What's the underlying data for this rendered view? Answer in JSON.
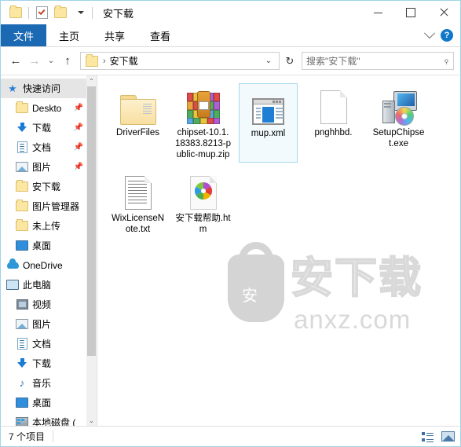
{
  "window": {
    "title": "安下载",
    "quick_access_toolbar": [
      {
        "name": "folder-icon",
        "label": "属性"
      },
      {
        "name": "properties-icon",
        "label": "属性"
      },
      {
        "name": "new-folder-icon",
        "label": "新建文件夹"
      },
      {
        "name": "customize-dropdown",
        "label": "▾"
      }
    ],
    "controls": {
      "minimize": "—",
      "maximize": "▢",
      "close": "✕"
    }
  },
  "ribbon": {
    "tabs": [
      {
        "label": "文件",
        "active": true
      },
      {
        "label": "主页",
        "active": false
      },
      {
        "label": "共享",
        "active": false
      },
      {
        "label": "查看",
        "active": false
      }
    ],
    "collapse_label": "⌄",
    "help_label": "?"
  },
  "address_bar": {
    "back": "←",
    "forward": "→",
    "recent": "⌄",
    "up": "↑",
    "breadcrumb_separator": "›",
    "path": "安下载",
    "path_dropdown": "⌄",
    "refresh": "↻",
    "search_placeholder": "搜索\"安下载\"",
    "search_value": "",
    "search_icon": "⌕"
  },
  "sidebar": {
    "items": [
      {
        "label": "快速访问",
        "icon": "star-pin-icon",
        "level": 1,
        "selected": true,
        "pinned": false
      },
      {
        "label": "Deskto",
        "icon": "folder-icon",
        "level": 2,
        "selected": false,
        "pinned": true
      },
      {
        "label": "下载",
        "icon": "download-icon",
        "level": 2,
        "selected": false,
        "pinned": true
      },
      {
        "label": "文档",
        "icon": "document-icon",
        "level": 2,
        "selected": false,
        "pinned": true
      },
      {
        "label": "图片",
        "icon": "pictures-icon",
        "level": 2,
        "selected": false,
        "pinned": true
      },
      {
        "label": "安下载",
        "icon": "folder-icon",
        "level": 2,
        "selected": false,
        "pinned": false
      },
      {
        "label": "图片管理器",
        "icon": "folder-icon",
        "level": 2,
        "selected": false,
        "pinned": false
      },
      {
        "label": "未上传",
        "icon": "folder-icon",
        "level": 2,
        "selected": false,
        "pinned": false
      },
      {
        "label": "桌面",
        "icon": "desktop-icon",
        "level": 2,
        "selected": false,
        "pinned": false
      },
      {
        "label": "OneDrive",
        "icon": "cloud-icon",
        "level": 1,
        "selected": false,
        "pinned": false
      },
      {
        "label": "此电脑",
        "icon": "computer-icon",
        "level": 1,
        "selected": false,
        "pinned": false
      },
      {
        "label": "视频",
        "icon": "video-icon",
        "level": 2,
        "selected": false,
        "pinned": false
      },
      {
        "label": "图片",
        "icon": "pictures-icon",
        "level": 2,
        "selected": false,
        "pinned": false
      },
      {
        "label": "文档",
        "icon": "document-icon",
        "level": 2,
        "selected": false,
        "pinned": false
      },
      {
        "label": "下载",
        "icon": "download-icon",
        "level": 2,
        "selected": false,
        "pinned": false
      },
      {
        "label": "音乐",
        "icon": "music-icon",
        "level": 2,
        "selected": false,
        "pinned": false
      },
      {
        "label": "桌面",
        "icon": "desktop-icon",
        "level": 2,
        "selected": false,
        "pinned": false
      },
      {
        "label": "本地磁盘 (",
        "icon": "disk-icon",
        "level": 2,
        "selected": false,
        "pinned": false
      }
    ],
    "scroll_up": "⌃",
    "scroll_down": "⌄"
  },
  "files": [
    {
      "name": "DriverFiles",
      "icon": "folder-icon",
      "selected": false
    },
    {
      "name": "chipset-10.1.18383.8213-public-mup.zip",
      "icon": "zip-archive-icon",
      "selected": false
    },
    {
      "name": "mup.xml",
      "icon": "xml-file-icon",
      "selected": true
    },
    {
      "name": "pnghhbd.",
      "icon": "blank-page-icon",
      "selected": false
    },
    {
      "name": "SetupChipset.exe",
      "icon": "setup-executable-icon",
      "selected": false
    },
    {
      "name": "WixLicenseNote.txt",
      "icon": "text-file-icon",
      "selected": false
    },
    {
      "name": "安下载帮助.htm",
      "icon": "html-file-icon",
      "selected": false
    }
  ],
  "watermark": {
    "glyph": "安",
    "text": "安下载",
    "url": "anxz.com"
  },
  "status_bar": {
    "item_count": "7 个项目",
    "view_details": "详细信息",
    "view_large_icons": "大图标"
  }
}
